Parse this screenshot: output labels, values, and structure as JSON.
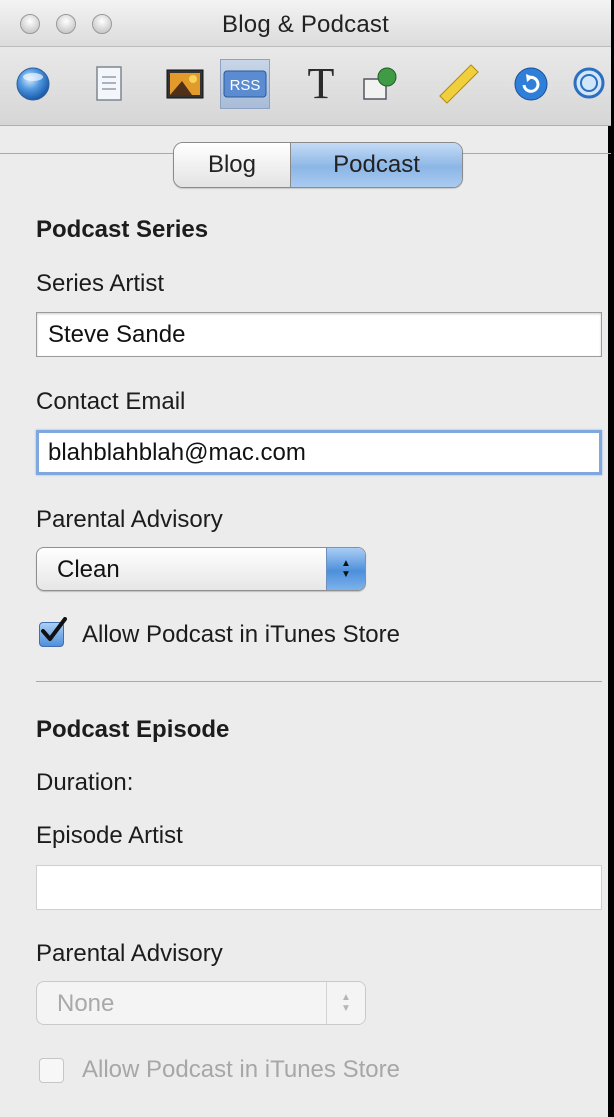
{
  "window": {
    "title": "Blog & Podcast"
  },
  "toolbar": {
    "items": [
      {
        "icon": "globe-icon"
      },
      {
        "icon": "document-icon"
      },
      {
        "icon": "photo-icon"
      },
      {
        "icon": "rss-icon",
        "label": "RSS",
        "active": true
      },
      {
        "icon": "text-icon",
        "label": "T"
      },
      {
        "icon": "shapes-icon"
      },
      {
        "icon": "ruler-icon"
      },
      {
        "icon": "refresh-icon"
      },
      {
        "icon": "zoom-icon"
      }
    ]
  },
  "tabs": {
    "blog": "Blog",
    "podcast": "Podcast",
    "selected": "Podcast"
  },
  "series": {
    "heading": "Podcast Series",
    "artist_label": "Series Artist",
    "artist_value": "Steve Sande",
    "email_label": "Contact Email",
    "email_value": "blahblahblah@mac.com",
    "advisory_label": "Parental Advisory",
    "advisory_value": "Clean",
    "itunes_label": "Allow Podcast in iTunes Store",
    "itunes_checked": true
  },
  "episode": {
    "heading": "Podcast Episode",
    "duration_label": "Duration:",
    "artist_label": "Episode Artist",
    "artist_value": "",
    "advisory_label": "Parental Advisory",
    "advisory_value": "None",
    "itunes_label": "Allow Podcast in iTunes Store",
    "itunes_checked": false
  },
  "colors": {
    "accent": "#4f8fdc",
    "selected_tab": "#8cb6e6",
    "panel_bg": "#ececec"
  }
}
